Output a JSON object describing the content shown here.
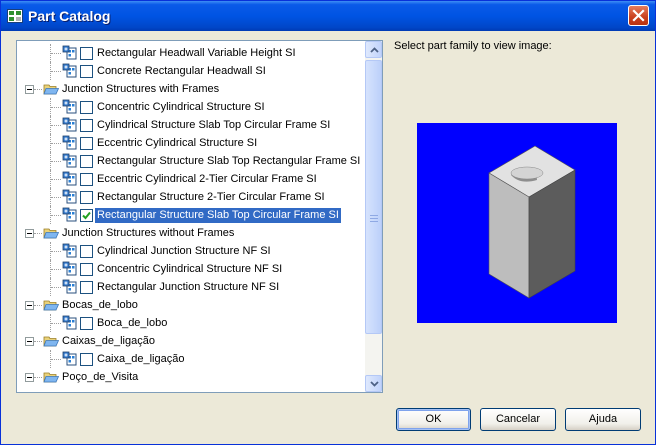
{
  "window": {
    "title": "Part Catalog"
  },
  "tree": {
    "rows": [
      {
        "type": "part",
        "label": "Rectangular Headwall Variable Height SI",
        "checked": false,
        "selected": false
      },
      {
        "type": "part",
        "label": "Concrete Rectangular Headwall SI",
        "checked": false,
        "selected": false
      },
      {
        "type": "group",
        "label": "Junction Structures with Frames"
      },
      {
        "type": "part",
        "label": "Concentric Cylindrical Structure SI",
        "checked": false,
        "selected": false
      },
      {
        "type": "part",
        "label": "Cylindrical Structure Slab Top Circular Frame SI",
        "checked": false,
        "selected": false
      },
      {
        "type": "part",
        "label": "Eccentric Cylindrical Structure SI",
        "checked": false,
        "selected": false
      },
      {
        "type": "part",
        "label": "Rectangular Structure Slab Top Rectangular Frame SI",
        "checked": false,
        "selected": false
      },
      {
        "type": "part",
        "label": "Eccentric Cylindrical 2-Tier Circular Frame SI",
        "checked": false,
        "selected": false
      },
      {
        "type": "part",
        "label": "Rectangular Structure 2-Tier Circular Frame SI",
        "checked": false,
        "selected": false
      },
      {
        "type": "part",
        "label": "Rectangular Structure Slab Top Circular Frame SI",
        "checked": true,
        "selected": true
      },
      {
        "type": "group",
        "label": "Junction Structures without Frames"
      },
      {
        "type": "part",
        "label": "Cylindrical Junction Structure NF SI",
        "checked": false,
        "selected": false
      },
      {
        "type": "part",
        "label": "Concentric Cylindrical Structure NF SI",
        "checked": false,
        "selected": false
      },
      {
        "type": "part",
        "label": "Rectangular Junction Structure NF SI",
        "checked": false,
        "selected": false
      },
      {
        "type": "group",
        "label": "Bocas_de_lobo"
      },
      {
        "type": "part",
        "label": "Boca_de_lobo",
        "checked": false,
        "selected": false
      },
      {
        "type": "group",
        "label": "Caixas_de_ligação"
      },
      {
        "type": "part",
        "label": "Caixa_de_ligação",
        "checked": false,
        "selected": false
      },
      {
        "type": "group",
        "label": "Poço_de_Visita"
      }
    ],
    "scroll_position": 0.05
  },
  "preview": {
    "label": "Select part family to view image:",
    "background": "#0000ff"
  },
  "buttons": {
    "ok": "OK",
    "cancel": "Cancelar",
    "help": "Ajuda"
  },
  "colors": {
    "title_bar": "#0054e3",
    "selection": "#316ac5",
    "dialog": "#ece9d8"
  }
}
